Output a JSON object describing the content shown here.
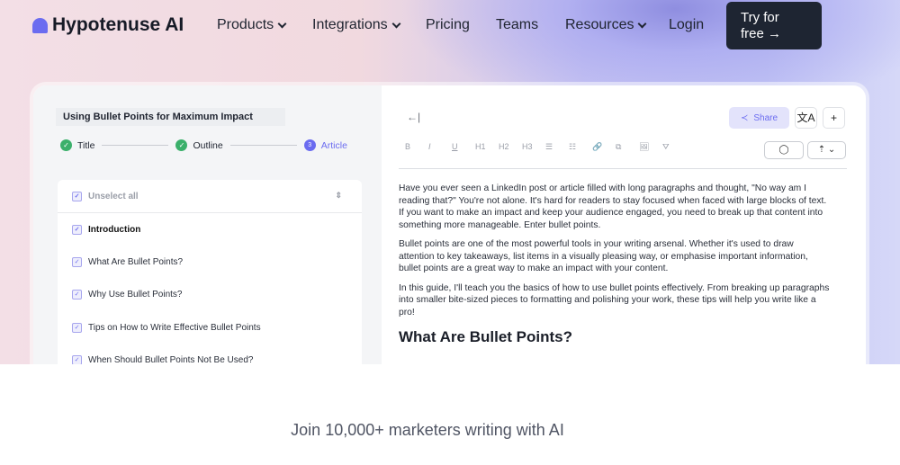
{
  "nav": {
    "brand": "Hypotenuse AI",
    "items": [
      {
        "label": "Products",
        "dropdown": true
      },
      {
        "label": "Integrations",
        "dropdown": true
      },
      {
        "label": "Pricing"
      },
      {
        "label": "Teams"
      },
      {
        "label": "Resources",
        "dropdown": true
      },
      {
        "label": "Login"
      }
    ],
    "cta_line1": "Try for",
    "cta_line2": "free →"
  },
  "left": {
    "doc_title": "Using Bullet Points for Maximum Impact",
    "steps": [
      {
        "label": "Title",
        "state": "done"
      },
      {
        "label": "Outline",
        "state": "done"
      },
      {
        "num": "3",
        "label": "Article",
        "state": "current"
      }
    ],
    "unselect_all": "Unselect all",
    "outline": [
      "Introduction",
      "What Are Bullet Points?",
      "Why Use Bullet Points?",
      "Tips on How to Write Effective Bullet Points",
      "When Should Bullet Points Not Be Used?"
    ]
  },
  "editor": {
    "back": "←|",
    "share": "Share",
    "translate": "文A",
    "add": "+",
    "toolbar": [
      "B",
      "I",
      "U",
      "H1",
      "H2",
      "H3",
      "☰",
      "☷",
      "🔗",
      "⧉",
      "🖼",
      "⛛"
    ],
    "shield": "◯",
    "export": "⇡ ⌄",
    "paragraphs": [
      "Have you ever seen a LinkedIn post or article filled with long paragraphs and thought, \"No way am I reading that?\" You're not alone. It's hard for readers to stay focused when faced with large blocks of text. If you want to make an impact and keep your audience engaged, you need to break up that content into something more manageable. Enter bullet points.",
      "Bullet points are one of the most powerful tools in your writing arsenal. Whether it's used to draw attention to key takeaways, list items in a visually pleasing way, or emphasise important information, bullet points are a great way to make an impact with your content.",
      "In this guide, I'll teach you the basics of how to use bullet points effectively. From breaking up paragraphs into smaller bite-sized pieces to formatting and polishing your work, these tips will help you write like a pro!"
    ],
    "heading": "What Are Bullet Points?"
  },
  "footer": {
    "tagline": "Join 10,000+ marketers writing with AI"
  },
  "colors": {
    "accent": "#6b6cf0",
    "success": "#3bb06b",
    "cta": "#1e2532"
  }
}
